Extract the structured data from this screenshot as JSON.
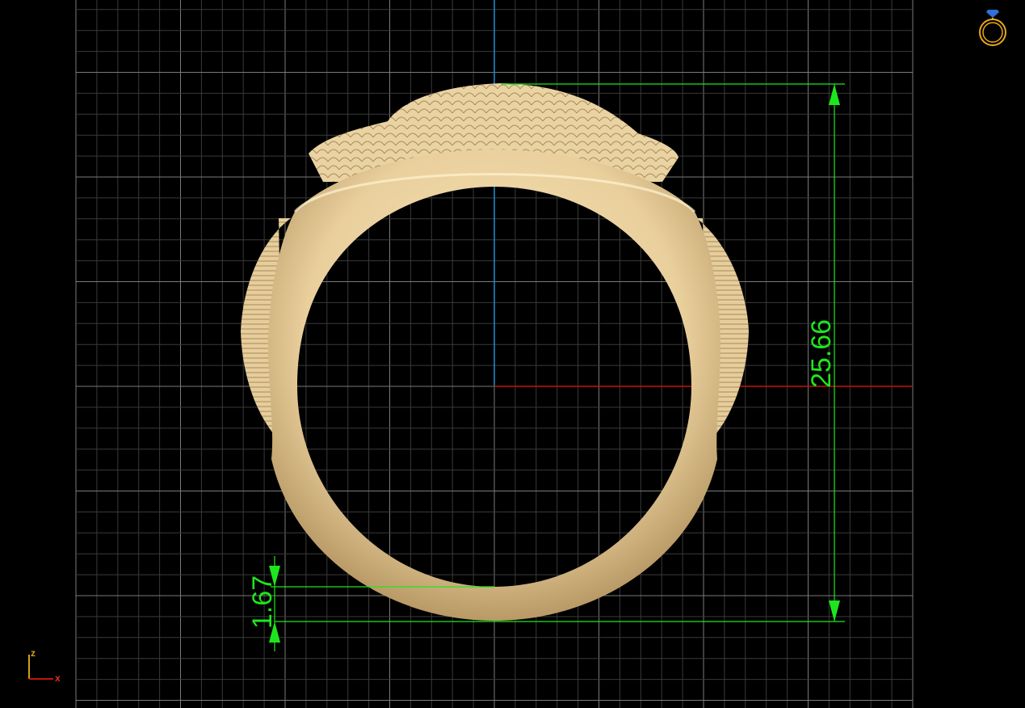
{
  "viewport": {
    "view": "front",
    "colors": {
      "background": "#000000",
      "grid_minor": "#3a3a3a",
      "grid_major": "#7a7a7a",
      "axis_x": "#c0160c",
      "axis_z": "#1e8fd0",
      "dimension": "#1ee61e",
      "model": "#efd9a8"
    }
  },
  "dimensions": {
    "height_label": "25.66",
    "thickness_label": "1.67"
  },
  "axis_indicator": {
    "z_label": "z",
    "x_label": "x"
  },
  "view_cube": {
    "icon": "ring-icon"
  }
}
